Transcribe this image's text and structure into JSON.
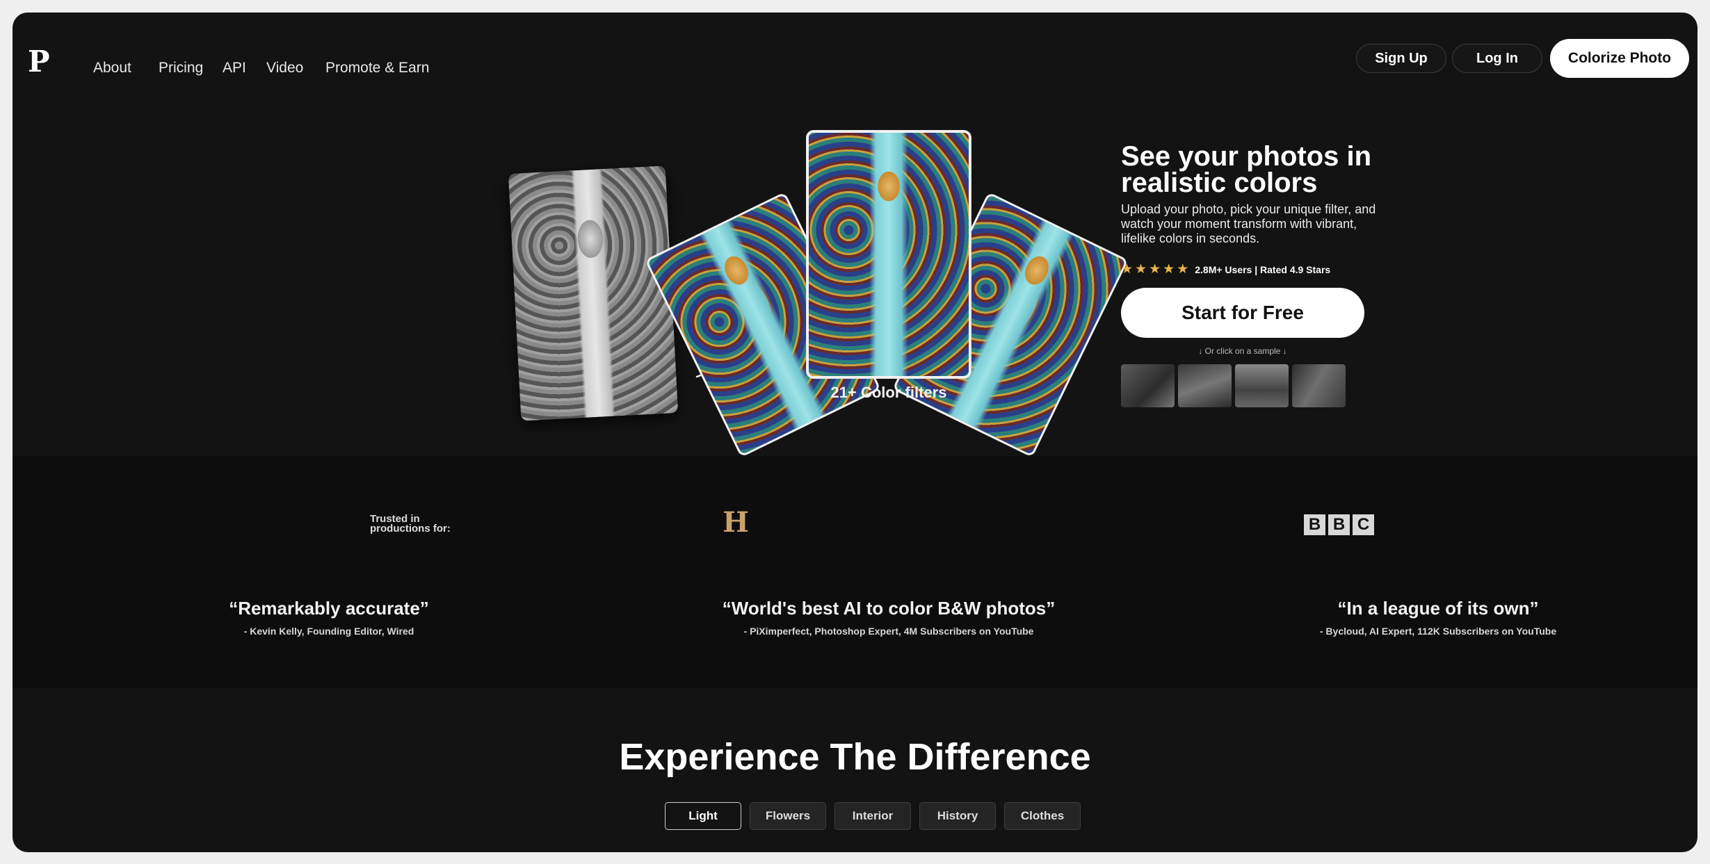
{
  "nav": {
    "logo": "P",
    "links": [
      "About",
      "Pricing",
      "API",
      "Video",
      "Promote & Earn"
    ],
    "sign_up": "Sign Up",
    "log_in": "Log In",
    "colorize": "Colorize Photo"
  },
  "hero": {
    "filters_caption": "21+ Color filters",
    "title": "See your photos in realistic colors",
    "description": "Upload your photo, pick your unique filter, and watch your moment transform with vibrant, lifelike colors in seconds.",
    "rating": {
      "stars": 5,
      "text": "2.8M+ Users | Rated 4.9 Stars"
    },
    "cta": "Start for Free",
    "sample_hint": "↓ Or click on a sample ↓"
  },
  "trusted": {
    "label_line1": "Trusted in",
    "label_line2": "productions for:",
    "logos": [
      "history-logo",
      "bbc-logo"
    ],
    "history_letter": "H",
    "bbc_letters": [
      "B",
      "B",
      "C"
    ]
  },
  "quotes": [
    {
      "text": "“Remarkably accurate”",
      "by": "- Kevin Kelly, Founding Editor, Wired"
    },
    {
      "text": "“World's best AI to color B&W photos”",
      "by": "- PiXimperfect, Photoshop Expert, 4M Subscribers on YouTube"
    },
    {
      "text": "“In a league of its own”",
      "by": "- Bycloud, AI Expert, 112K Subscribers on YouTube"
    }
  ],
  "experience": {
    "title": "Experience The Difference",
    "tabs": [
      "Light",
      "Flowers",
      "Interior",
      "History",
      "Clothes"
    ],
    "active_tab": "Light"
  },
  "colors": {
    "background": "#141314",
    "star": "#e7b64a",
    "band": "#0e0d0e"
  }
}
